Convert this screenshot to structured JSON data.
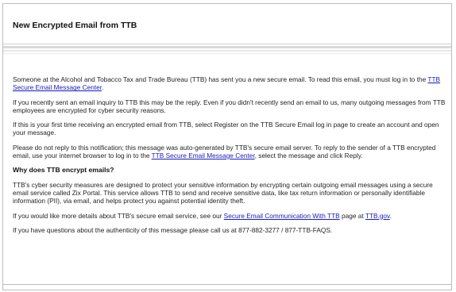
{
  "header": {
    "title": "New Encrypted Email from TTB"
  },
  "body": {
    "p1_text": "Someone at the Alcohol and Tobacco Tax and Trade Bureau (TTB) has sent you a new secure email. To read this email, you must log in to the ",
    "p1_link": "TTB Secure Email Message Center",
    "p1_after": ".",
    "p2_text": "If you recently sent an email inquiry to TTB this may be the reply. Even if you didn't recently send an email to us, many outgoing messages from TTB employees are encrypted for cyber security reasons.",
    "p3_text": "If this is your first time receiving an encrypted email from TTB, select Register on the TTB Secure Email log in page to create an account and open your message.",
    "p4_text": "Please do not reply to this notification; this message was auto-generated by TTB's secure email server. To reply to the sender of a TTB encrypted email, use your internet browser to log in to the ",
    "p4_link": "TTB Secure Email Message Center",
    "p4_after": ", select the message and click Reply.",
    "heading_why": "Why does TTB encrypt emails?",
    "p5_text": "TTB's cyber security measures are designed to protect your sensitive information by encrypting certain outgoing email messages using a secure email service called Zix Portal. This service allows TTB to send and receive sensitive data, like tax return information or personally identifiable information (PII), via email, and helps protect you against potential identity theft.",
    "p6_text": "If you would like more details about TTB's secure email service, see our ",
    "p6_link": "Secure Email Communication With TTB",
    "p6_middle": " page at ",
    "p6_link2": "TTB.gov",
    "p6_after": ".",
    "p7_text": "If you have questions about the authenticity of this message please call us at 877-882-3277 / 877-TTB-FAQS."
  },
  "colors": {
    "link": "#1a1ab8",
    "text": "#1f1f1f",
    "rule": "#d9d9d9"
  }
}
